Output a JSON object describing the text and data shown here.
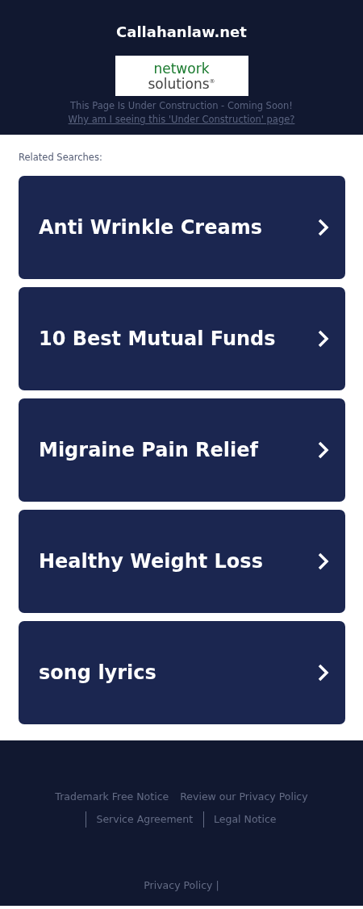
{
  "header": {
    "domain": "Callahanlaw.net",
    "logo": {
      "line_1": "network",
      "line_2": "solutions",
      "mark": "®"
    },
    "notice": "This Page Is Under Construction - Coming Soon!",
    "why_link": "Why am I seeing this 'Under Construction' page?"
  },
  "related": {
    "heading": "Related Searches:",
    "items": [
      {
        "label": "Anti Wrinkle Creams"
      },
      {
        "label": "10 Best Mutual Funds"
      },
      {
        "label": "Migraine Pain Relief"
      },
      {
        "label": "Healthy Weight Loss"
      },
      {
        "label": "song lyrics"
      }
    ]
  },
  "footer": {
    "links": [
      {
        "label": "Trademark Free Notice",
        "divider": false
      },
      {
        "label": "Review our Privacy Policy",
        "divider": false
      },
      {
        "label": "Service Agreement",
        "divider": true
      },
      {
        "label": "Legal Notice",
        "divider": true
      }
    ],
    "bottom_link": "Privacy Policy",
    "bottom_separator": "|"
  }
}
